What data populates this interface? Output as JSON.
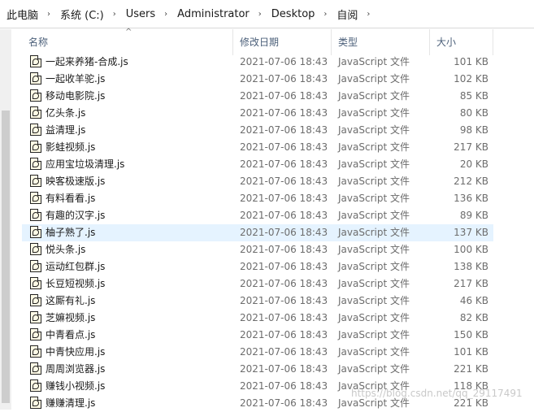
{
  "breadcrumb": [
    "此电脑",
    "系统 (C:)",
    "Users",
    "Administrator",
    "Desktop",
    "自阅"
  ],
  "breadcrumb_separator": "›",
  "columns": {
    "name": "名称",
    "date": "修改日期",
    "type": "类型",
    "size": "大小"
  },
  "sort_indicator": "^",
  "selected_index": 10,
  "files": [
    {
      "name": "一起来养猪-合成.js",
      "date": "2021-07-06 18:43",
      "type": "JavaScript 文件",
      "size": "101 KB"
    },
    {
      "name": "一起收羊驼.js",
      "date": "2021-07-06 18:43",
      "type": "JavaScript 文件",
      "size": "102 KB"
    },
    {
      "name": "移动电影院.js",
      "date": "2021-07-06 18:43",
      "type": "JavaScript 文件",
      "size": "85 KB"
    },
    {
      "name": "亿头条.js",
      "date": "2021-07-06 18:43",
      "type": "JavaScript 文件",
      "size": "80 KB"
    },
    {
      "name": "益清理.js",
      "date": "2021-07-06 18:43",
      "type": "JavaScript 文件",
      "size": "98 KB"
    },
    {
      "name": "影蛙视频.js",
      "date": "2021-07-06 18:43",
      "type": "JavaScript 文件",
      "size": "217 KB"
    },
    {
      "name": "应用宝垃圾清理.js",
      "date": "2021-07-06 18:43",
      "type": "JavaScript 文件",
      "size": "20 KB"
    },
    {
      "name": "映客极速版.js",
      "date": "2021-07-06 18:43",
      "type": "JavaScript 文件",
      "size": "212 KB"
    },
    {
      "name": "有料看看.js",
      "date": "2021-07-06 18:43",
      "type": "JavaScript 文件",
      "size": "136 KB"
    },
    {
      "name": "有趣的汉字.js",
      "date": "2021-07-06 18:43",
      "type": "JavaScript 文件",
      "size": "89 KB"
    },
    {
      "name": "柚子熟了.js",
      "date": "2021-07-06 18:43",
      "type": "JavaScript 文件",
      "size": "137 KB"
    },
    {
      "name": "悦头条.js",
      "date": "2021-07-06 18:43",
      "type": "JavaScript 文件",
      "size": "100 KB"
    },
    {
      "name": "运动红包群.js",
      "date": "2021-07-06 18:43",
      "type": "JavaScript 文件",
      "size": "138 KB"
    },
    {
      "name": "长豆短视频.js",
      "date": "2021-07-06 18:43",
      "type": "JavaScript 文件",
      "size": "217 KB"
    },
    {
      "name": "这厮有礼.js",
      "date": "2021-07-06 18:43",
      "type": "JavaScript 文件",
      "size": "46 KB"
    },
    {
      "name": "芝嫲视频.js",
      "date": "2021-07-06 18:43",
      "type": "JavaScript 文件",
      "size": "82 KB"
    },
    {
      "name": "中青看点.js",
      "date": "2021-07-06 18:43",
      "type": "JavaScript 文件",
      "size": "150 KB"
    },
    {
      "name": "中青快应用.js",
      "date": "2021-07-06 18:43",
      "type": "JavaScript 文件",
      "size": "101 KB"
    },
    {
      "name": "周周浏览器.js",
      "date": "2021-07-06 18:43",
      "type": "JavaScript 文件",
      "size": "221 KB"
    },
    {
      "name": "赚钱小视频.js",
      "date": "2021-07-06 18:43",
      "type": "JavaScript 文件",
      "size": "118 KB"
    },
    {
      "name": "赚赚清理.js",
      "date": "2021-07-06 18:43",
      "type": "JavaScript 文件",
      "size": "221 KB"
    }
  ],
  "watermark": "https://blog.csdn.net/qq_29117491"
}
